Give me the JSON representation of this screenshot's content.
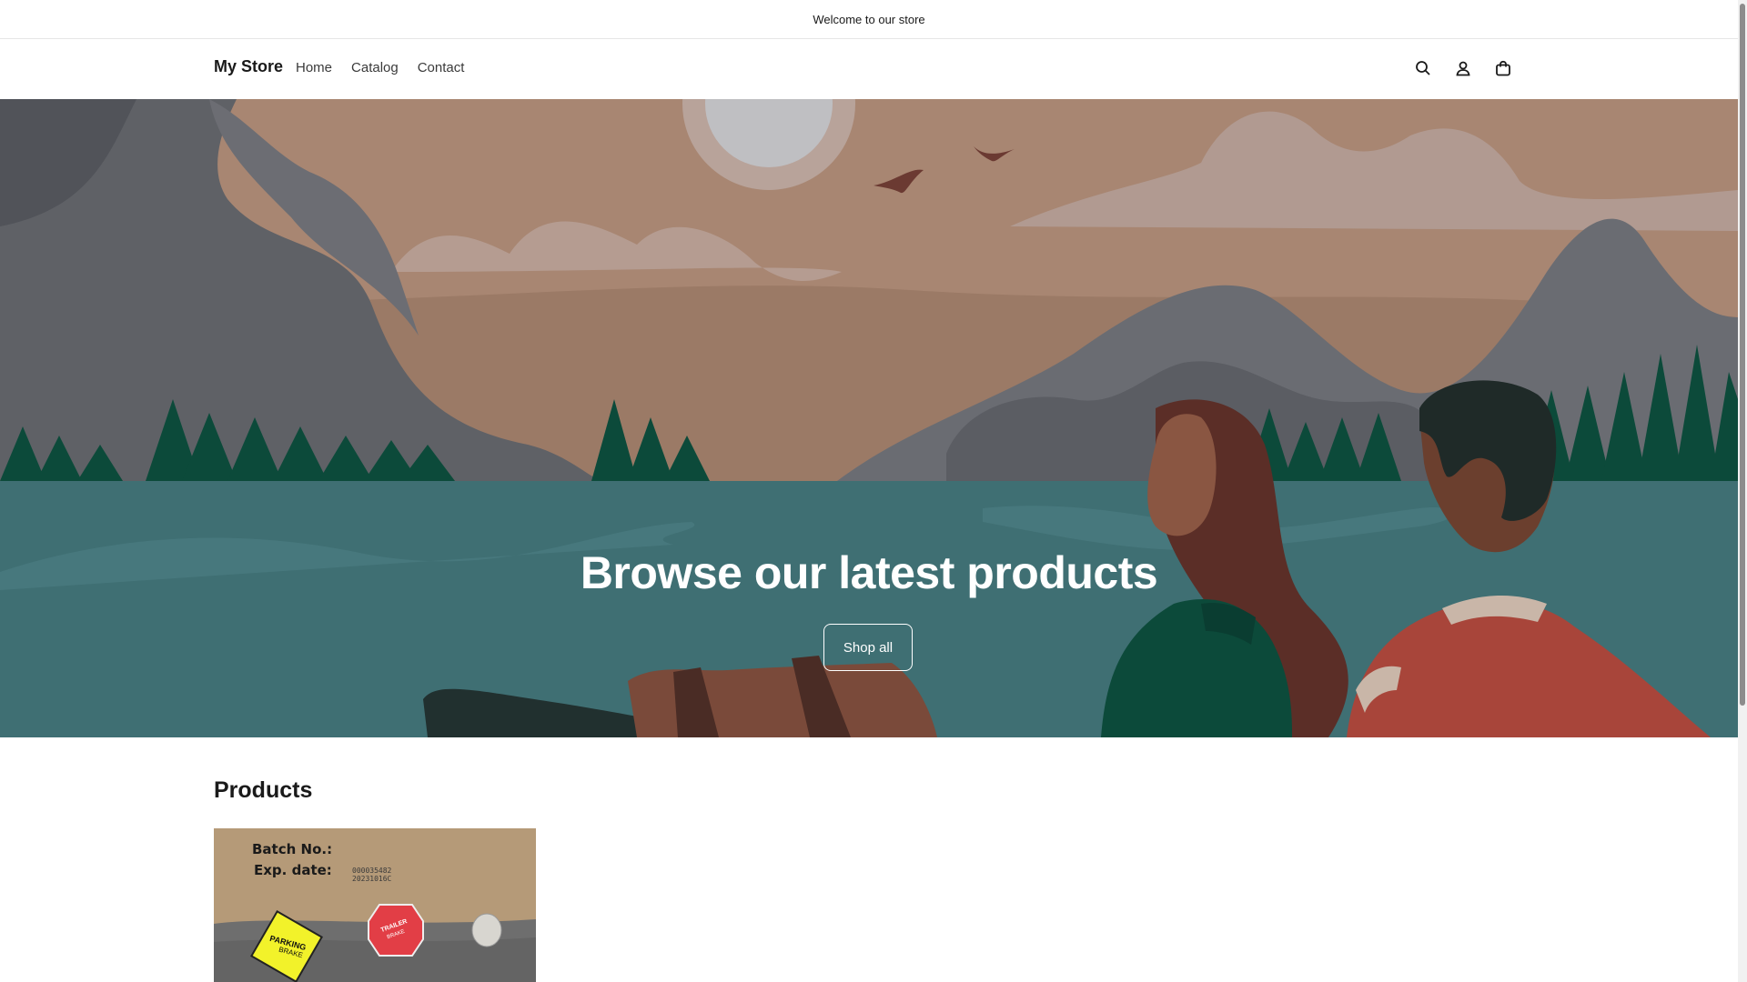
{
  "announcement": "Welcome to our store",
  "header": {
    "brand": "My Store",
    "nav": [
      "Home",
      "Catalog",
      "Contact"
    ],
    "icons": [
      "search-icon",
      "account-icon",
      "cart-icon"
    ]
  },
  "hero": {
    "title": "Browse our latest products",
    "button": "Shop all"
  },
  "products": {
    "heading": "Products",
    "items": [
      {
        "image_text_line1": "Batch No.:",
        "image_text_line2": "Exp. date:",
        "image_code1": "000035482",
        "image_code2": "20231016C",
        "badge1_line1": "PARKING",
        "badge1_line2": "BRAKE",
        "badge2_line1": "TRAILER",
        "badge2_line2": "BRAKE"
      }
    ]
  },
  "colors": {
    "sky": "#a9826c",
    "water": "#3f6f73",
    "mountain": "#5f6166",
    "trees": "#0c4a3a",
    "accent": "#ffffff"
  }
}
